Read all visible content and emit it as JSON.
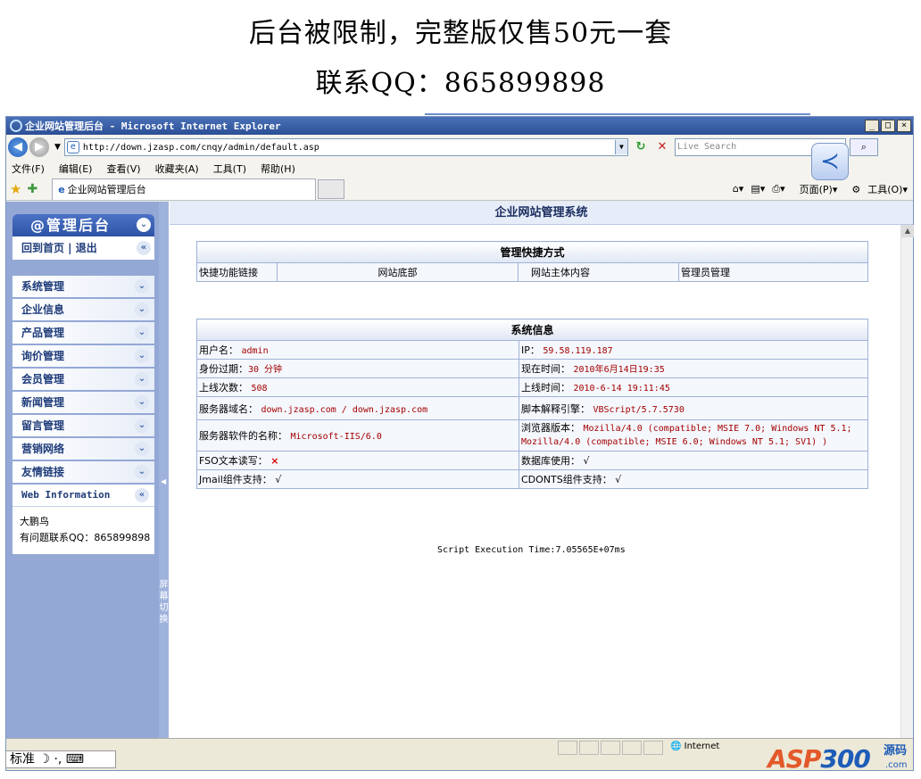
{
  "banner": {
    "line1": "后台被限制，完整版仅售50元一套",
    "line2": "联系QQ：865899898"
  },
  "window": {
    "title": "企业网站管理后台 - Microsoft Internet Explorer",
    "btn_min": "_",
    "btn_max": "□",
    "btn_close": "×"
  },
  "address": {
    "url": "http://down.jzasp.com/cnqy/admin/default.asp",
    "search_placeholder": "Live Search",
    "go": "⌕"
  },
  "menu": [
    "文件(F)",
    "编辑(E)",
    "查看(V)",
    "收藏夹(A)",
    "工具(T)",
    "帮助(H)"
  ],
  "tabbar": {
    "tab_title": "企业网站管理后台",
    "page_label": "页面(P)",
    "tools_label": "工具(O)"
  },
  "sidebar": {
    "header": "@管理后台",
    "links": "回到首页 | 退出",
    "items": [
      "系统管理",
      "企业信息",
      "产品管理",
      "询价管理",
      "会员管理",
      "新闻管理",
      "留言管理",
      "营销网络",
      "友情链接"
    ],
    "web_info": "Web Information",
    "info_name": "大鹏鸟",
    "info_contact": "有问题联系QQ：865899898",
    "switch": "屏幕切换"
  },
  "main": {
    "title": "企业网站管理系统",
    "shortcut_header": "管理快捷方式",
    "shortcuts": [
      "快捷功能链接",
      "网站底部",
      "网站主体内容",
      "管理员管理"
    ],
    "sysinfo_header": "系统信息",
    "rows": [
      {
        "l_label": "用户名：",
        "l_val": "admin",
        "r_label": "IP：",
        "r_val": "59.58.119.187"
      },
      {
        "l_label": "身份过期：",
        "l_val": "30 分钟",
        "r_label": "现在时间：",
        "r_val": "2010年6月14日19:35"
      },
      {
        "l_label": "上线次数：",
        "l_val": "508",
        "r_label": "上线时间：",
        "r_val": "2010-6-14 19:11:45"
      },
      {
        "l_label": "服务器域名：",
        "l_val": "down.jzasp.com / down.jzasp.com",
        "r_label": "脚本解释引擎：",
        "r_val": "VBScript/5.7.5730"
      },
      {
        "l_label": "服务器软件的名称：",
        "l_val": "Microsoft-IIS/6.0",
        "r_label": "浏览器版本：",
        "r_val": "Mozilla/4.0 (compatible; MSIE 7.0; Windows NT 5.1; Mozilla/4.0 (compatible; MSIE 6.0; Windows NT 5.1; SV1) )"
      },
      {
        "l_label": "FSO文本读写：",
        "l_val": "×",
        "r_label": "数据库使用：",
        "r_val": "√"
      },
      {
        "l_label": "Jmail组件支持：",
        "l_val": "√",
        "r_label": "CDONTS组件支持：",
        "r_val": "√"
      }
    ],
    "exec": "Script Execution Time:7.05565E+07ms"
  },
  "status": {
    "zone": "Internet"
  },
  "ime": "标准",
  "logo": {
    "asp": "ASP",
    "num": "300",
    "ym": "源码",
    "com": ".com"
  }
}
